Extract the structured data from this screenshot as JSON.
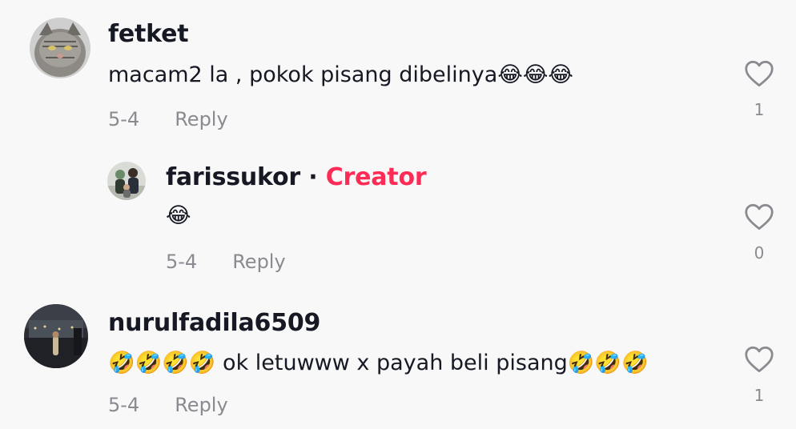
{
  "comments": [
    {
      "username": "fetket",
      "text": "macam2 la , pokok pisang dibelinya😂😂😂",
      "date": "5-4",
      "reply_label": "Reply",
      "likes": "1",
      "avatar_icon": "cat-avatar"
    },
    {
      "username": "farissukor",
      "separator": "·",
      "badge": "Creator",
      "text": "😂",
      "date": "5-4",
      "reply_label": "Reply",
      "likes": "0",
      "avatar_icon": "family-photo-avatar"
    },
    {
      "username": "nurulfadila6509",
      "text": "🤣🤣🤣🤣 ok letuwww x payah beli pisang🤣🤣🤣",
      "date": "5-4",
      "reply_label": "Reply",
      "likes": "1",
      "avatar_icon": "city-photo-avatar"
    }
  ],
  "colors": {
    "background": "#f8f8f8",
    "text": "#161823",
    "muted": "#8a8b91",
    "creator": "#fe2c55"
  }
}
